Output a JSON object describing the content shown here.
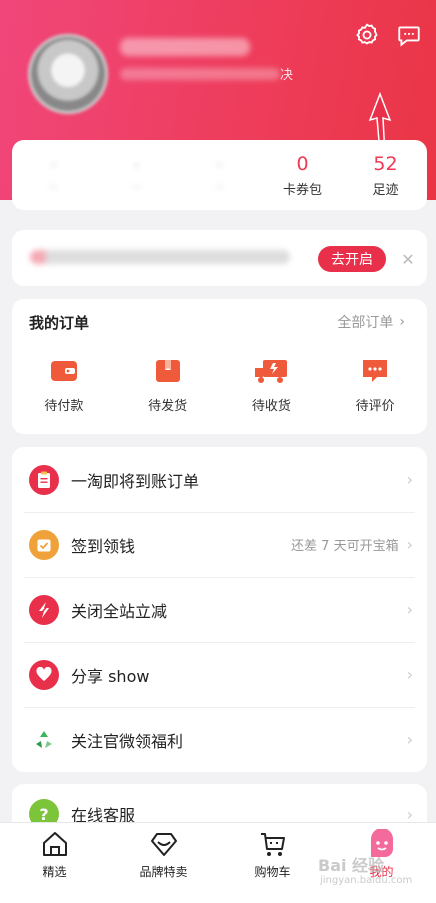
{
  "header": {
    "subline_tail": "决",
    "colors": {
      "accent": "#e8304a",
      "gradient_start": "#f0467a",
      "gradient_end": "#ea3545"
    },
    "icons": [
      "settings-icon",
      "message-icon"
    ]
  },
  "stats": [
    {
      "value": "",
      "label": ""
    },
    {
      "value": "",
      "label": ""
    },
    {
      "value": "",
      "label": ""
    },
    {
      "value": "0",
      "label": "卡券包"
    },
    {
      "value": "52",
      "label": "足迹"
    }
  ],
  "notice": {
    "button_label": "去开启",
    "close_icon": "close-icon"
  },
  "orders": {
    "title": "我的订单",
    "all_label": "全部订单",
    "items": [
      {
        "label": "待付款",
        "icon": "wallet-icon"
      },
      {
        "label": "待发货",
        "icon": "package-icon"
      },
      {
        "label": "待收货",
        "icon": "truck-icon"
      },
      {
        "label": "待评价",
        "icon": "comment-icon"
      }
    ]
  },
  "menu": [
    {
      "label": "一淘即将到账订单",
      "extra": "",
      "icon": "clipboard-icon",
      "color": "#e8304a"
    },
    {
      "label": "签到领钱",
      "extra": "还差 7 天可开宝箱",
      "icon": "checkin-icon",
      "color": "#f0a23a"
    },
    {
      "label": "关闭全站立减",
      "extra": "",
      "icon": "lightning-icon",
      "color": "#e8304a"
    },
    {
      "label": "分享 show",
      "extra": "",
      "icon": "heart-icon",
      "color": "#e8304a"
    },
    {
      "label": "关注官微领福利",
      "extra": "",
      "icon": "recycle-icon",
      "color": "#3bb55a"
    }
  ],
  "service": {
    "label": "在线客服",
    "icon": "question-icon",
    "color": "#7cc43a"
  },
  "tabbar": [
    {
      "label": "精选",
      "icon": "home-icon",
      "active": false
    },
    {
      "label": "品牌特卖",
      "icon": "diamond-icon",
      "active": false
    },
    {
      "label": "购物车",
      "icon": "cart-icon",
      "active": false
    },
    {
      "label": "我的",
      "icon": "profile-icon",
      "active": true
    }
  ],
  "watermark": {
    "text": "Bai 经验",
    "sub": "jingyan.baidu.com"
  }
}
